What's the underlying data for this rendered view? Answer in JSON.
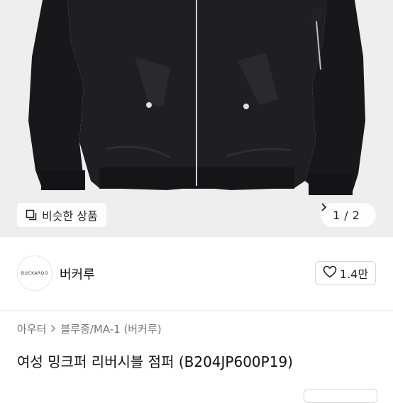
{
  "gallery": {
    "similar_label": "비슷한 상품",
    "page_current": "1",
    "page_separator": "/",
    "page_total": "2"
  },
  "brand": {
    "logo_text": "BUCKAROO",
    "name": "버커루",
    "like_count": "1.4만"
  },
  "breadcrumb": {
    "items": [
      "아우터",
      "블루종/MA-1 (버커루)"
    ]
  },
  "product": {
    "title": "여성 밍크퍼 리버시블 점퍼 (B204JP600P19)"
  },
  "colors": {
    "hero_bg": "#eeeeee",
    "jacket": "#1f1f21"
  },
  "icons": [
    "similar-products-icon",
    "chevron-right-icon",
    "heart-icon",
    "breadcrumb-chevron-icon"
  ]
}
